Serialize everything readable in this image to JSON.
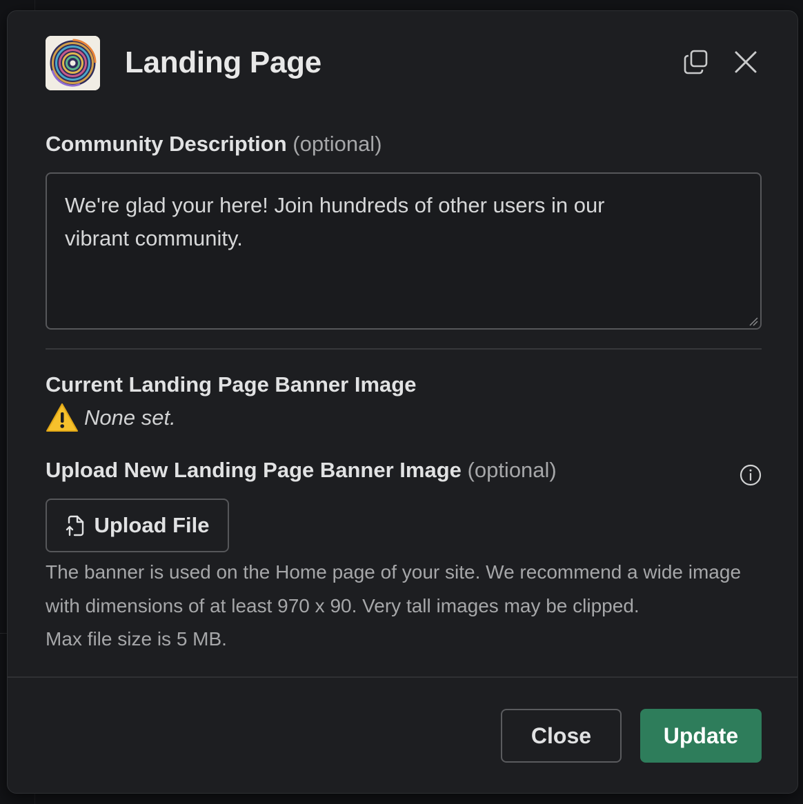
{
  "modal": {
    "title": "Landing Page"
  },
  "description": {
    "label": "Community Description",
    "optional": "(optional)",
    "value": "We're glad your here! Join hundreds of other users in our vibrant community."
  },
  "current_banner": {
    "heading": "Current Landing Page Banner Image",
    "status": "None set."
  },
  "upload": {
    "label": "Upload New Landing Page Banner Image",
    "optional": "(optional)",
    "button_label": "Upload File",
    "help_lines": [
      "The banner is used on the Home page of your site. We recommend a wide image",
      "with dimensions of at least 970 x 90. Very tall images may be clipped.",
      "Max file size is 5 MB."
    ]
  },
  "footer": {
    "close_label": "Close",
    "update_label": "Update"
  },
  "colors": {
    "background": "#1d1e21",
    "primary_button": "#2e7d5b",
    "warning": "#f6c12c"
  },
  "icons": [
    "app-logo",
    "copy-icon",
    "close-icon",
    "warning-icon",
    "info-icon",
    "upload-file-icon",
    "resize-handle-icon"
  ]
}
